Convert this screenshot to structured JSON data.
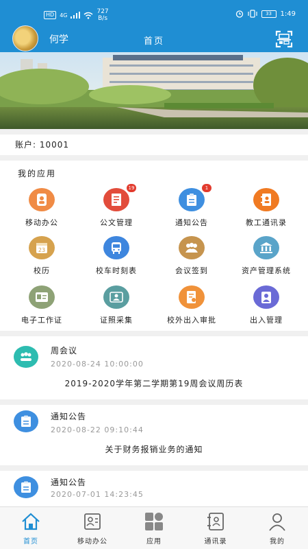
{
  "status_bar": {
    "network_tag": "HD",
    "signal": "4G",
    "speed_value": "727",
    "speed_unit": "B/s",
    "battery": "33",
    "time": "1:49"
  },
  "header": {
    "username": "何学",
    "title": "首页"
  },
  "account": {
    "text": "账户: 10001"
  },
  "apps_section": {
    "title": "我的应用",
    "items": [
      {
        "label": "移动办公",
        "icon": "mobile-office-icon",
        "color": "#f08b45"
      },
      {
        "label": "公文管理",
        "icon": "document-icon",
        "color": "#e24c3b",
        "badge": "19"
      },
      {
        "label": "通知公告",
        "icon": "clipboard-icon",
        "color": "#3e8fe0",
        "badge": "1"
      },
      {
        "label": "教工通讯录",
        "icon": "contact-book-icon",
        "color": "#f07a22"
      },
      {
        "label": "校历",
        "icon": "calendar-icon",
        "color": "#d6a24e"
      },
      {
        "label": "校车时刻表",
        "icon": "bus-icon",
        "color": "#3e86de"
      },
      {
        "label": "会议签到",
        "icon": "meeting-icon",
        "color": "#c6944e"
      },
      {
        "label": "资产管理系统",
        "icon": "bank-icon",
        "color": "#5aa4c9"
      },
      {
        "label": "电子工作证",
        "icon": "id-card-icon",
        "color": "#8ea276"
      },
      {
        "label": "证照采集",
        "icon": "photo-icon",
        "color": "#5a9ea0"
      },
      {
        "label": "校外出入审批",
        "icon": "approval-icon",
        "color": "#f0923a"
      },
      {
        "label": "出入管理",
        "icon": "user-badge-icon",
        "color": "#6a6ad6"
      }
    ]
  },
  "messages": [
    {
      "title": "周会议",
      "time": "2020-08-24 10:00:00",
      "content": "2019-2020学年第二学期第19周会议周历表",
      "icon": "meeting-group-icon",
      "color": "#2dbcb0"
    },
    {
      "title": "通知公告",
      "time": "2020-08-22 09:10:44",
      "content": "关于财务报销业务的通知",
      "icon": "clipboard-icon",
      "color": "#3e8fe0"
    },
    {
      "title": "通知公告",
      "time": "2020-07-01 14:23:45",
      "content": "",
      "icon": "clipboard-icon",
      "color": "#3e8fe0"
    }
  ],
  "tabbar": {
    "items": [
      {
        "label": "首页",
        "icon": "home-icon",
        "active": true
      },
      {
        "label": "移动办公",
        "icon": "id-card-tab-icon"
      },
      {
        "label": "应用",
        "icon": "apps-grid-icon"
      },
      {
        "label": "通讯录",
        "icon": "address-book-icon"
      },
      {
        "label": "我的",
        "icon": "person-icon"
      }
    ]
  },
  "colors": {
    "brand": "#1f8ed3",
    "badge": "#e23b2e",
    "tab_active": "#1f8ed3"
  }
}
